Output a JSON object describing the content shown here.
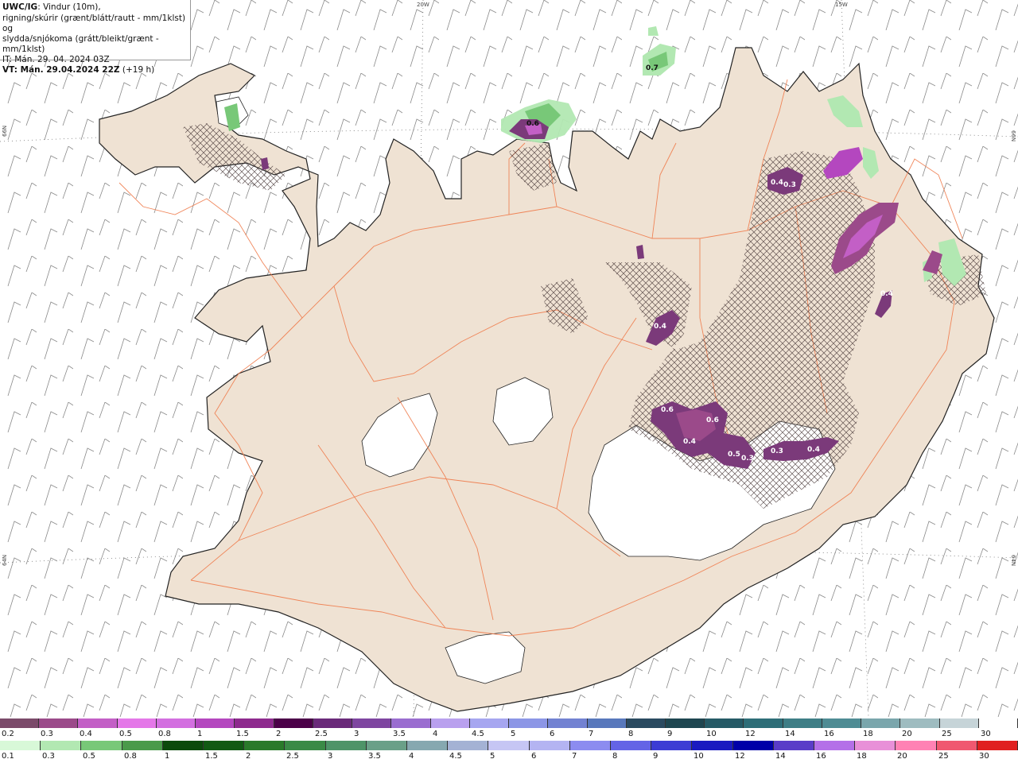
{
  "info": {
    "model": "UWC/IG",
    "line1_rest": ": Vindur (10m),",
    "line2": "rigning/skúrir (grænt/blátt/rautt - mm/1klst) og",
    "line3": "slydda/snjókoma (grátt/bleikt/grænt - mm/1klst)",
    "line4": "IT: Mán. 29. 04. 2024 03Z",
    "vt_label": "VT: Mán. 29.04.2024 22Z",
    "vt_offset": " (+19 h)"
  },
  "grid_labels": {
    "top_20w": "20W",
    "top_15w": "15W",
    "left_66n": "66N",
    "right_66n": "66N",
    "left_64n": "64N",
    "right_64n": "64N"
  },
  "precip_labels": [
    "0.7",
    "0.6",
    "0.4",
    "0.3",
    "0.4",
    "0.6",
    "0.6",
    "0.4",
    "0.5",
    "0.3",
    "0.3",
    "0.4",
    "0.4"
  ],
  "legend_snow": {
    "labels": [
      "0.2",
      "0.3",
      "0.4",
      "0.5",
      "0.8",
      "1",
      "1.5",
      "2",
      "2.5",
      "3",
      "3.5",
      "4",
      "4.5",
      "5",
      "6",
      "7",
      "8",
      "9",
      "10",
      "12",
      "14",
      "16",
      "18",
      "20",
      "25",
      "30"
    ],
    "colors": [
      "#7b4a6a",
      "#9b4a8a",
      "#c35fc6",
      "#e478e8",
      "#d36fe0",
      "#b447bf",
      "#8e2a8e",
      "#4b0048",
      "#6a2a7a",
      "#7e45a0",
      "#9a6dd0",
      "#b9a0ee",
      "#a6a6f0",
      "#8c96e6",
      "#7282d2",
      "#5878bc",
      "#2a4a60",
      "#1e4650",
      "#255a66",
      "#2e6e78",
      "#3e7e86",
      "#4e8c94",
      "#7aa6ac",
      "#9ebcc0",
      "#c6d4d8",
      "#ffffff"
    ]
  },
  "legend_rain": {
    "labels": [
      "0.1",
      "0.3",
      "0.5",
      "0.8",
      "1",
      "1.5",
      "2",
      "2.5",
      "3",
      "3.5",
      "4",
      "4.5",
      "5",
      "6",
      "7",
      "8",
      "9",
      "10",
      "12",
      "14",
      "16",
      "18",
      "20",
      "25",
      "30"
    ],
    "colors": [
      "#d8f8d8",
      "#b2e8b2",
      "#78c878",
      "#4a9a4a",
      "#0c4a0c",
      "#125a14",
      "#2a7a2a",
      "#3a8a46",
      "#4e9468",
      "#6aa088",
      "#86a8b0",
      "#a4b2d4",
      "#c6c6f4",
      "#b4b4f2",
      "#8c8cf0",
      "#6464e6",
      "#3c3cd4",
      "#1a1ac0",
      "#0000a8",
      "#5a3cc8",
      "#b470e8",
      "#e890d8",
      "#ff82b4",
      "#f05870",
      "#e02020"
    ]
  }
}
